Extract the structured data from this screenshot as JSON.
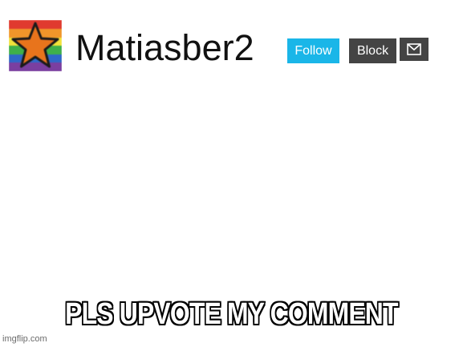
{
  "profile": {
    "avatar_icon": "rainbow-star-avatar",
    "username": "Matiasber2"
  },
  "actions": {
    "follow_label": "Follow",
    "block_label": "Block",
    "message_icon": "envelope-icon"
  },
  "meme": {
    "caption": "PLS UPVOTE MY COMMENT",
    "watermark": "imgflip.com"
  },
  "colors": {
    "follow_button": "#1ab6e8",
    "block_button": "#444444",
    "star_fill": "#e8741c",
    "caption_fill": "#ffffff",
    "caption_outline": "#000000",
    "rainbow": [
      "#e03a2f",
      "#f0962a",
      "#f2e23a",
      "#3fb04a",
      "#2f68c8",
      "#7a3fa0"
    ]
  }
}
